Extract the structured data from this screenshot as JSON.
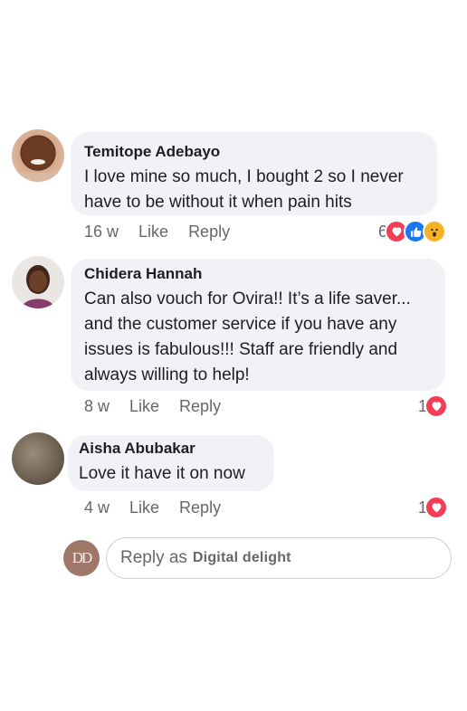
{
  "comments": [
    {
      "author": "Temitope Adebayo",
      "lines": [
        "I love mine so much, I bought 2 so I never",
        "have to be without it when pain hits"
      ],
      "age": "16 w",
      "like_label": "Like",
      "reply_label": "Reply",
      "reaction_count": "6",
      "reactions": [
        "heart-icon",
        "like-icon",
        "wow-icon"
      ]
    },
    {
      "author": "Chidera Hannah",
      "lines": [
        "Can also vouch for Ovira!! It’s a life saver...",
        "and the customer service if you have any",
        "issues is fabulous!!! Staff are friendly and",
        "always willing to help!"
      ],
      "age": "8 w",
      "like_label": "Like",
      "reply_label": "Reply",
      "reaction_count": "1",
      "reactions": [
        "heart-icon"
      ]
    },
    {
      "author": "Aisha Abubakar",
      "lines": [
        "Love it have it on now"
      ],
      "age": "4 w",
      "like_label": "Like",
      "reply_label": "Reply",
      "reaction_count": "1",
      "reactions": [
        "heart-icon"
      ]
    }
  ],
  "reply_box": {
    "avatar_initials": "DD",
    "prefix": "Reply as",
    "name": "Digital delight"
  },
  "colors": {
    "bubble": "#f0f2f5",
    "meta_text": "#65676b",
    "heart": "#f33e58",
    "like": "#1877f2",
    "wow": "#f7b125",
    "avatar_dd": "#a0786a"
  }
}
